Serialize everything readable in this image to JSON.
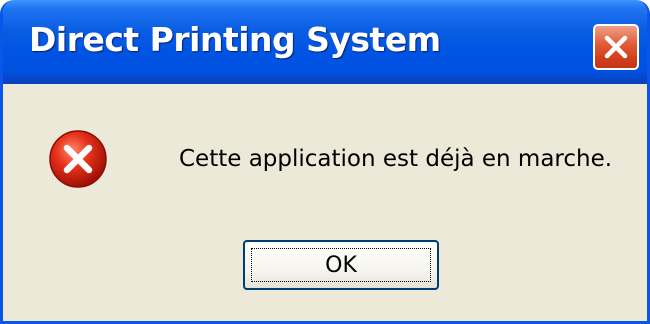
{
  "window": {
    "title": "Direct Printing System"
  },
  "titlebar": {
    "close_icon": "close-icon",
    "close_color": "#e05a36"
  },
  "dialog": {
    "icon": "error-icon",
    "message": "Cette application est déjà en marche.",
    "ok_label": "OK"
  },
  "colors": {
    "titlebar": "#0054e3",
    "window_border": "#0a56e8",
    "dialog_background": "#ece9d8",
    "error_red": "#d81e05"
  }
}
